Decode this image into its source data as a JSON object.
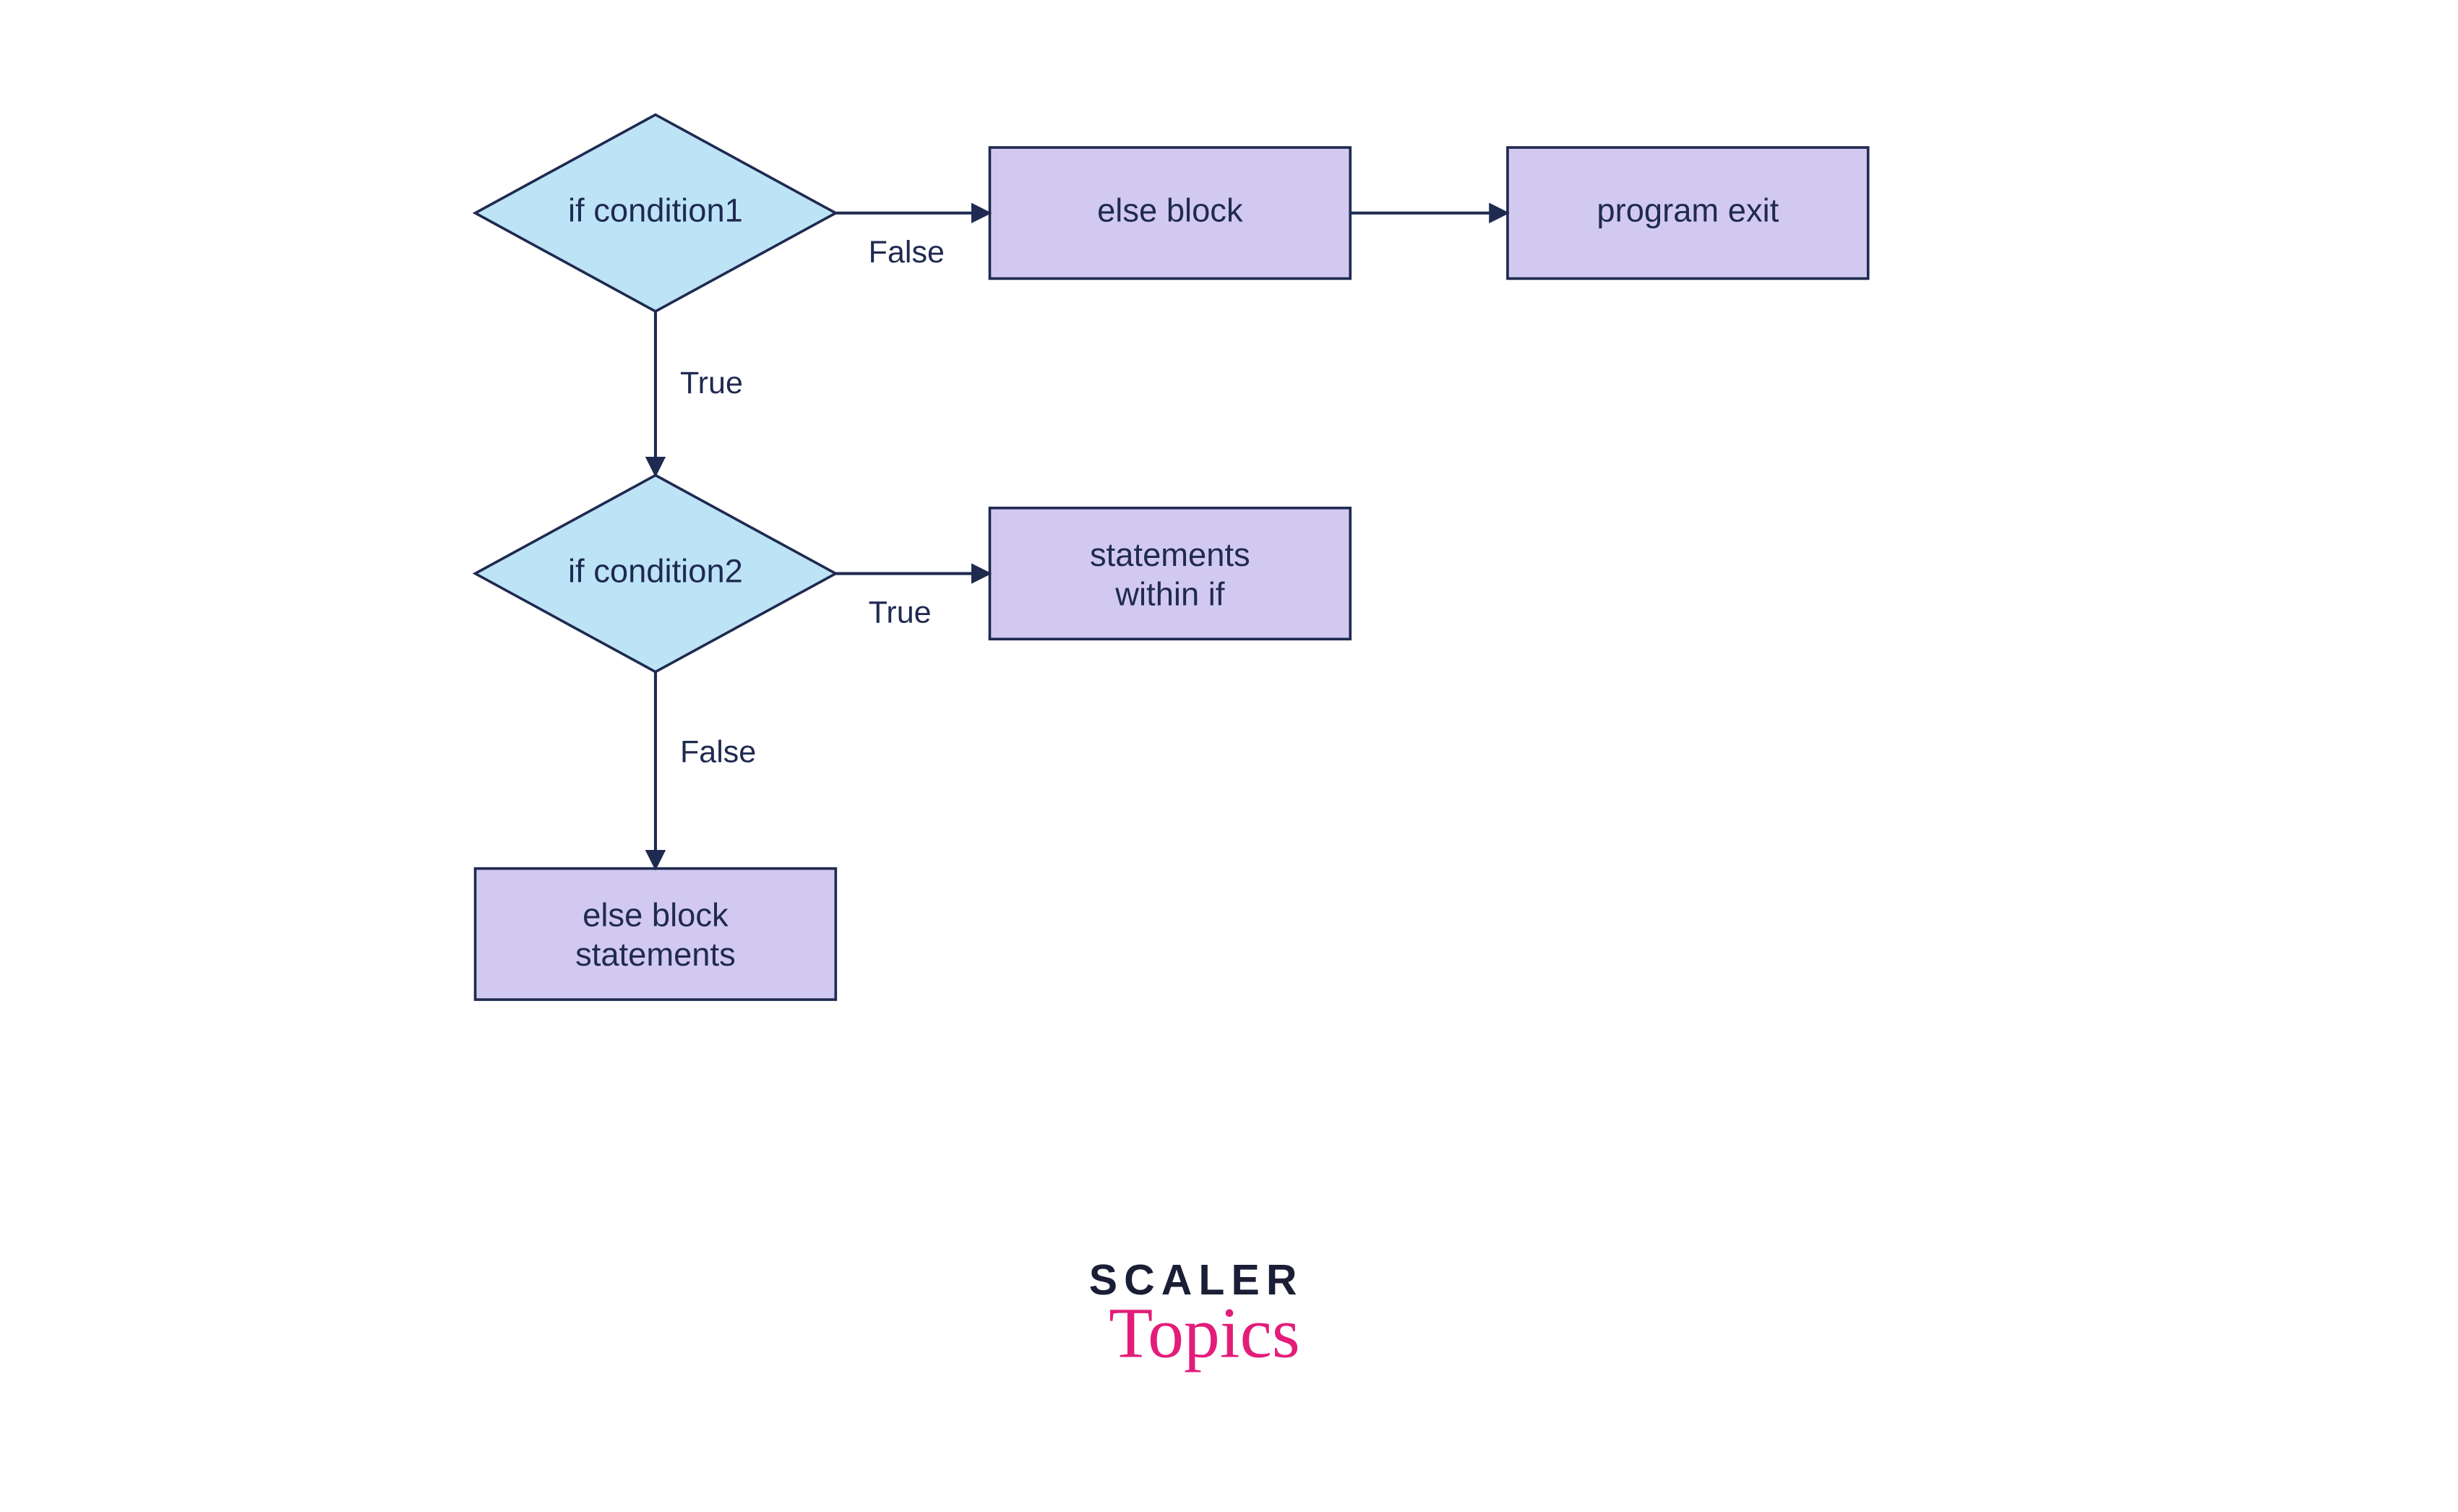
{
  "nodes": {
    "cond1": {
      "label": "if condition1"
    },
    "cond2": {
      "label": "if condition2"
    },
    "elseBlock": {
      "label": "else block"
    },
    "programExit": {
      "label": "program exit"
    },
    "stmtsIf": {
      "line1": "statements",
      "line2": "within if"
    },
    "elseStmts": {
      "line1": "else block",
      "line2": "statements"
    }
  },
  "edges": {
    "cond1_right": "False",
    "cond1_down": "True",
    "cond2_right": "True",
    "cond2_down": "False"
  },
  "branding": {
    "line1": "SCALER",
    "line2": "Topics"
  },
  "colors": {
    "diamondFill": "#bde3f6",
    "rectFill": "#d2c9f1",
    "stroke": "#1f2a50",
    "brandPink": "#e31c79"
  }
}
